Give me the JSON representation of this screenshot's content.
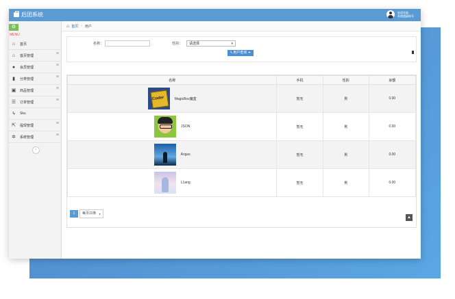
{
  "app": {
    "title": "后团系统"
  },
  "user": {
    "line1": "欢迎光临,",
    "line2": "系统超级帐号"
  },
  "sidebar": {
    "menu_label": "MENU",
    "items": [
      {
        "label": "首页",
        "icon": "home-icon",
        "has_arrow": false
      },
      {
        "label": "首页管理",
        "icon": "home-icon",
        "has_arrow": true
      },
      {
        "label": "会员管理",
        "icon": "user-icon",
        "has_arrow": true
      },
      {
        "label": "分类管理",
        "icon": "bookmark-icon",
        "has_arrow": true
      },
      {
        "label": "商品管理",
        "icon": "gift-icon",
        "has_arrow": true
      },
      {
        "label": "订单管理",
        "icon": "list-icon",
        "has_arrow": true
      },
      {
        "label": "Sku",
        "icon": "bolt-icon",
        "has_arrow": false
      },
      {
        "label": "提现管理",
        "icon": "export-icon",
        "has_arrow": true
      },
      {
        "label": "系统管理",
        "icon": "cogs-icon",
        "has_arrow": true
      }
    ]
  },
  "breadcrumb": {
    "home": "首页",
    "current": "用户"
  },
  "filter": {
    "nickname_label": "名称：",
    "nickname_value": "",
    "gender_label": "性别：",
    "gender_selected": "请选择",
    "search_label": "用户查询"
  },
  "table": {
    "columns": [
      "名称",
      "手机",
      "性别",
      "余额"
    ],
    "rows": [
      {
        "name": "MagicBox魔盒",
        "phone": "暂无",
        "gender": "男",
        "balance": "0.00"
      },
      {
        "name": "JSON",
        "phone": "暂无",
        "gender": "男",
        "balance": "0.00"
      },
      {
        "name": "Angus",
        "phone": "暂无",
        "gender": "男",
        "balance": "0.00"
      },
      {
        "name": "L1ang",
        "phone": "暂无",
        "gender": "男",
        "balance": "0.00"
      }
    ]
  },
  "pagination": {
    "current_page": "1",
    "page_size": "每页10条"
  },
  "colors": {
    "primary": "#5b9bd5",
    "accent_green": "#7bbf5a",
    "link": "#2a6fb7"
  }
}
